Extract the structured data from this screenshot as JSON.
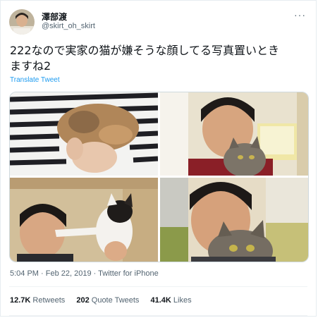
{
  "author": {
    "display_name": "澤部渡",
    "handle": "@skirt_oh_skirt"
  },
  "tweet": {
    "text_line1": "222なので実家の猫が嫌そうな顔してる写真置いとき",
    "text_line2": "ますね2",
    "translate_label": "Translate Tweet",
    "time": "5:04 PM",
    "date": "Feb 22, 2019",
    "separator": " · ",
    "source": "Twitter for iPhone"
  },
  "stats": {
    "retweets_count": "12.7K",
    "retweets_label": "Retweets",
    "quote_count": "202",
    "quote_label": "Quote Tweets",
    "likes_count": "41.4K",
    "likes_label": "Likes"
  },
  "icons": {
    "more": "more-options-icon"
  },
  "colors": {
    "link": "#1d9bf0",
    "secondary_text": "#536471",
    "primary_text": "#0f1419"
  }
}
